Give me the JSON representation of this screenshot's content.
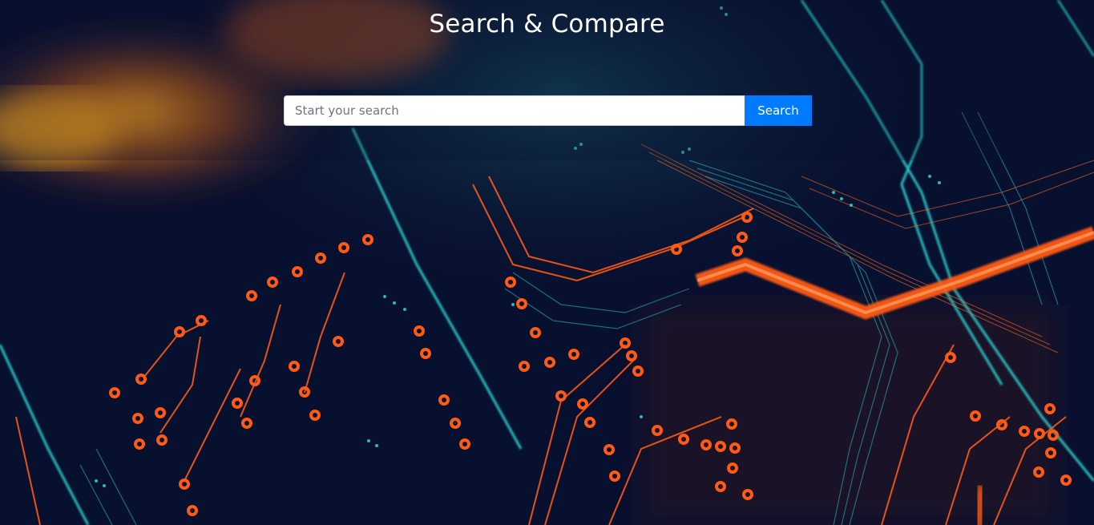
{
  "header": {
    "title": "Search & Compare"
  },
  "search": {
    "placeholder": "Start your search",
    "value": "",
    "button_label": "Search"
  },
  "colors": {
    "background": "#0a1028",
    "accent_orange": "#ff5a14",
    "accent_teal": "#2fd6d0",
    "button": "#007bff"
  }
}
